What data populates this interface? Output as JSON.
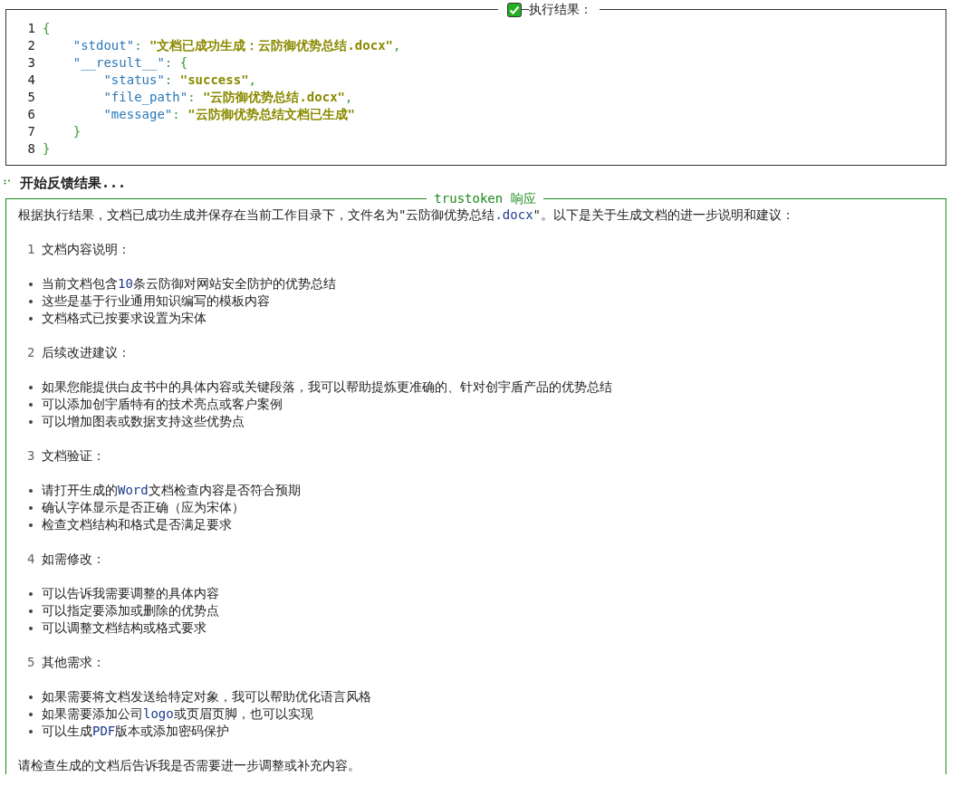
{
  "result_panel": {
    "title": "执行结果：",
    "lines": [
      {
        "number": "1",
        "tokens": [
          {
            "kind": "punct",
            "text": "{"
          }
        ]
      },
      {
        "number": "2",
        "tokens": [
          {
            "kind": "key",
            "text": "    \"stdout\""
          },
          {
            "kind": "punct",
            "text": ": "
          },
          {
            "kind": "string",
            "text": "\"文档已成功生成：云防御优势总结.docx\""
          },
          {
            "kind": "punct",
            "text": ","
          }
        ]
      },
      {
        "number": "3",
        "tokens": [
          {
            "kind": "key",
            "text": "    \"__result__\""
          },
          {
            "kind": "punct",
            "text": ": {"
          }
        ]
      },
      {
        "number": "4",
        "tokens": [
          {
            "kind": "key",
            "text": "        \"status\""
          },
          {
            "kind": "punct",
            "text": ": "
          },
          {
            "kind": "string",
            "text": "\"success\""
          },
          {
            "kind": "punct",
            "text": ","
          }
        ]
      },
      {
        "number": "5",
        "tokens": [
          {
            "kind": "key",
            "text": "        \"file_path\""
          },
          {
            "kind": "punct",
            "text": ": "
          },
          {
            "kind": "string",
            "text": "\"云防御优势总结.docx\""
          },
          {
            "kind": "punct",
            "text": ","
          }
        ]
      },
      {
        "number": "6",
        "tokens": [
          {
            "kind": "key",
            "text": "        \"message\""
          },
          {
            "kind": "punct",
            "text": ": "
          },
          {
            "kind": "string",
            "text": "\"云防御优势总结文档已生成\""
          }
        ]
      },
      {
        "number": "7",
        "tokens": [
          {
            "kind": "punct",
            "text": "    }"
          }
        ]
      },
      {
        "number": "8",
        "tokens": [
          {
            "kind": "punct",
            "text": "}"
          }
        ]
      }
    ]
  },
  "status_line": {
    "text": "开始反馈结果..."
  },
  "response_panel": {
    "title": "trustoken 响应",
    "blocks": [
      {
        "kind": "paragraph",
        "parts": [
          {
            "kind": "plain",
            "text": "根据执行结果，文档已成功生成并保存在当前工作目录下，文件名为\"云防御优势总结"
          },
          {
            "kind": "code",
            "text": ".docx"
          },
          {
            "kind": "plain",
            "text": "\"。以下是关于生成文档的进一步说明和建议："
          }
        ]
      },
      {
        "kind": "heading",
        "number": "1",
        "text": "文档内容说明："
      },
      {
        "kind": "bullets",
        "items": [
          [
            {
              "kind": "plain",
              "text": "当前文档包含"
            },
            {
              "kind": "code",
              "text": "10"
            },
            {
              "kind": "plain",
              "text": "条云防御对网站安全防护的优势总结"
            }
          ],
          [
            {
              "kind": "plain",
              "text": "这些是基于行业通用知识编写的模板内容"
            }
          ],
          [
            {
              "kind": "plain",
              "text": "文档格式已按要求设置为宋体"
            }
          ]
        ]
      },
      {
        "kind": "heading",
        "number": "2",
        "text": "后续改进建议："
      },
      {
        "kind": "bullets",
        "items": [
          [
            {
              "kind": "plain",
              "text": "如果您能提供白皮书中的具体内容或关键段落，我可以帮助提炼更准确的、针对创宇盾产品的优势总结"
            }
          ],
          [
            {
              "kind": "plain",
              "text": "可以添加创宇盾特有的技术亮点或客户案例"
            }
          ],
          [
            {
              "kind": "plain",
              "text": "可以增加图表或数据支持这些优势点"
            }
          ]
        ]
      },
      {
        "kind": "heading",
        "number": "3",
        "text": "文档验证："
      },
      {
        "kind": "bullets",
        "items": [
          [
            {
              "kind": "plain",
              "text": "请打开生成的"
            },
            {
              "kind": "code",
              "text": "Word"
            },
            {
              "kind": "plain",
              "text": "文档检查内容是否符合预期"
            }
          ],
          [
            {
              "kind": "plain",
              "text": "确认字体显示是否正确（应为宋体）"
            }
          ],
          [
            {
              "kind": "plain",
              "text": "检查文档结构和格式是否满足要求"
            }
          ]
        ]
      },
      {
        "kind": "heading",
        "number": "4",
        "text": "如需修改："
      },
      {
        "kind": "bullets",
        "items": [
          [
            {
              "kind": "plain",
              "text": "可以告诉我需要调整的具体内容"
            }
          ],
          [
            {
              "kind": "plain",
              "text": "可以指定要添加或删除的优势点"
            }
          ],
          [
            {
              "kind": "plain",
              "text": "可以调整文档结构或格式要求"
            }
          ]
        ]
      },
      {
        "kind": "heading",
        "number": "5",
        "text": "其他需求："
      },
      {
        "kind": "bullets",
        "items": [
          [
            {
              "kind": "plain",
              "text": "如果需要将文档发送给特定对象，我可以帮助优化语言风格"
            }
          ],
          [
            {
              "kind": "plain",
              "text": "如果需要添加公司"
            },
            {
              "kind": "code",
              "text": "logo"
            },
            {
              "kind": "plain",
              "text": "或页眉页脚，也可以实现"
            }
          ],
          [
            {
              "kind": "plain",
              "text": "可以生成"
            },
            {
              "kind": "code",
              "text": "PDF"
            },
            {
              "kind": "plain",
              "text": "版本或添加密码保护"
            }
          ]
        ]
      },
      {
        "kind": "paragraph",
        "parts": [
          {
            "kind": "plain",
            "text": "请检查生成的文档后告诉我是否需要进一步调整或补充内容。"
          }
        ]
      }
    ]
  }
}
